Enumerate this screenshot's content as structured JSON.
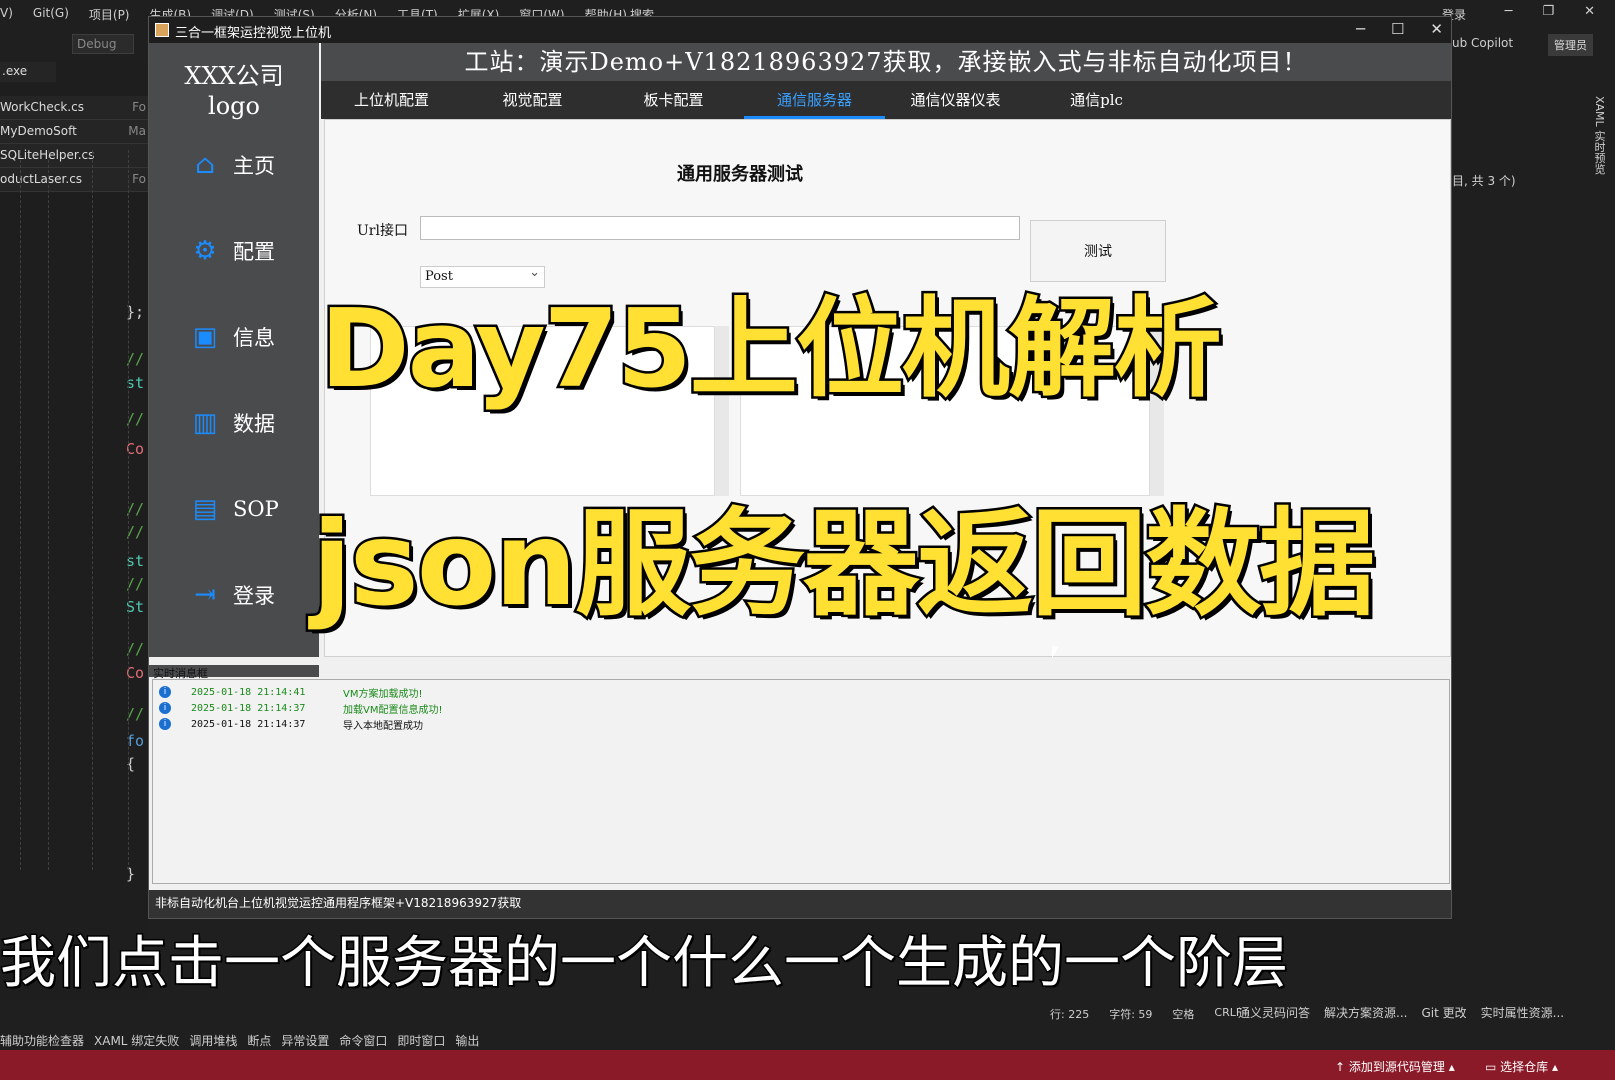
{
  "ide": {
    "menu": [
      "V)",
      "Git(G)",
      "项目(P)",
      "生成(B)",
      "调试(D)",
      "测试(S)",
      "分析(N)",
      "工具(T)",
      "扩展(X)",
      "窗口(W)",
      "帮助(H)"
    ],
    "search": "搜索",
    "login": "登录",
    "config": "Debug",
    "copilot": "ub Copilot",
    "admin": "管理员",
    "exe": ".exe",
    "tabs": [
      {
        "name": "WorkCheck.cs",
        "suffix": "Fo"
      },
      {
        "name": "MyDemoSoft",
        "suffix": "Ma"
      },
      {
        "name": "SQLiteHelper.cs",
        "suffix": ""
      },
      {
        "name": "oductLaser.cs",
        "suffix": "Fo"
      }
    ],
    "code_lines": [
      "};",
      "//",
      "st",
      "//",
      "Co",
      "//",
      "//",
      "st",
      "//",
      "St",
      "//",
      "Co",
      "//",
      "fo",
      "{",
      "}"
    ],
    "right_count": "目, 共 3 个)",
    "xaml_label": "XAML 实时预览",
    "bottom_panels": [
      "辅助功能检查器",
      "XAML 绑定失败",
      "调用堆栈",
      "断点",
      "异常设置",
      "命令窗口",
      "即时窗口",
      "输出"
    ],
    "position": {
      "line": "行: 225",
      "char": "字符: 59",
      "space": "空格",
      "eol": "CRLF"
    },
    "right_panels": [
      "通义灵码问答",
      "解决方案资源...",
      "Git 更改",
      "实时属性资源..."
    ],
    "status_source": "添加到源代码管理",
    "status_repo": "选择仓库"
  },
  "app": {
    "title": "三合一框架运控视觉上位机",
    "logo": [
      "XXX公司",
      "logo"
    ],
    "nav": [
      {
        "label": "主页",
        "icon": "home-icon",
        "glyph": "⌂"
      },
      {
        "label": "配置",
        "icon": "gear-icon",
        "glyph": "⚙"
      },
      {
        "label": "信息",
        "icon": "info-card-icon",
        "glyph": "▣"
      },
      {
        "label": "数据",
        "icon": "bar-chart-icon",
        "glyph": "▥"
      },
      {
        "label": "SOP",
        "icon": "book-icon",
        "glyph": "▤"
      },
      {
        "label": "登录",
        "icon": "login-icon",
        "glyph": "⇥"
      }
    ],
    "banner": "工站：演示Demo+V18218963927获取，承接嵌入式与非标自动化项目！",
    "tabs": [
      "上位机配置",
      "视觉配置",
      "板卡配置",
      "通信服务器",
      "通信仪器仪表",
      "通信plc"
    ],
    "active_tab": 3,
    "content_title": "通用服务器测试",
    "url_label": "Url接口",
    "url_value": "",
    "test_button": "测试",
    "method": "Post",
    "log_label": "实时消息框",
    "logs": [
      {
        "time": "2025-01-18 21:14:41",
        "msg": "VM方案加载成功!",
        "color": "#1a8a1a"
      },
      {
        "time": "2025-01-18 21:14:37",
        "msg": "加载VM配置信息成功!",
        "color": "#1a8a1a"
      },
      {
        "time": "2025-01-18 21:14:37",
        "msg": "导入本地配置成功",
        "color": "#111111"
      }
    ],
    "status": "非标自动化机台上位机视觉运控通用程序框架+V18218963927获取"
  },
  "overlay": {
    "line1": "Day75上位机解析",
    "line2": "json服务器返回数据",
    "subtitle": "我们点击一个服务器的一个什么一个生成的一个阶层"
  },
  "colors": {
    "accent": "#1a8cff",
    "overlay_yellow": "#ffe033",
    "status_red": "#8b1a29"
  }
}
